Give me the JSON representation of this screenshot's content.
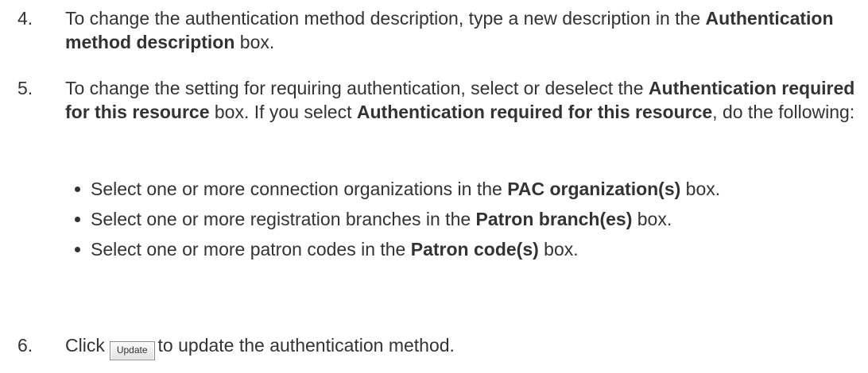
{
  "steps": {
    "s4": {
      "num": "4.",
      "t1": "To change the authentication method description, type a new description in the ",
      "b1": "Authentication method description",
      "t2": " box."
    },
    "s5": {
      "num": "5.",
      "t1": "To change the setting for requiring authentication, select or deselect the ",
      "b1": "Authentication required for this resource",
      "t2": " box. If you select ",
      "b2": "Authentication required for this resource",
      "t3": ", do the following:",
      "bullets": [
        {
          "t1": "Select one or more connection organizations in the ",
          "b": "PAC organization(s)",
          "t2": " box."
        },
        {
          "t1": "Select one or more registration branches in the ",
          "b": "Patron branch(es)",
          "t2": " box."
        },
        {
          "t1": "Select one or more patron codes in the ",
          "b": "Patron code(s)",
          "t2": " box."
        }
      ]
    },
    "s6": {
      "num": "6.",
      "t1": "Click",
      "button_label": "Update",
      "t2": "to update the authentication method."
    }
  }
}
